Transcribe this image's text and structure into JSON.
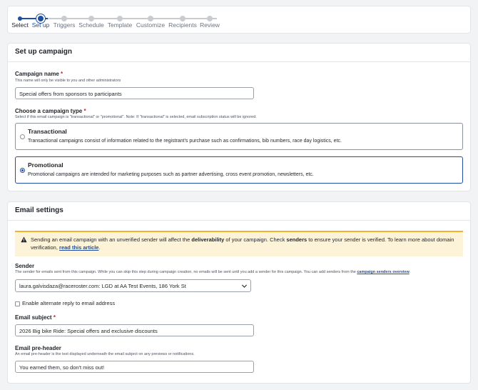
{
  "stepper": {
    "steps": [
      {
        "label": "Select",
        "state": "done"
      },
      {
        "label": "Set up",
        "state": "active"
      },
      {
        "label": "Triggers",
        "state": "upcoming"
      },
      {
        "label": "Schedule",
        "state": "upcoming"
      },
      {
        "label": "Template",
        "state": "upcoming"
      },
      {
        "label": "Customize",
        "state": "upcoming"
      },
      {
        "label": "Recipients",
        "state": "upcoming"
      },
      {
        "label": "Review",
        "state": "upcoming"
      }
    ]
  },
  "setup": {
    "title": "Set up campaign",
    "campaign_name": {
      "label": "Campaign name",
      "required_mark": "*",
      "help": "This name will only be visible to you and other administrators",
      "value": "Special offers from sponsors to participants"
    },
    "campaign_type": {
      "label": "Choose a campaign type",
      "required_mark": "*",
      "help": "Select if this email campaign is \"transactional\" or \"promotional\". Note: If \"transactional\" is selected, email subscription status will be ignored.",
      "options": [
        {
          "title": "Transactional",
          "description": "Transactional campaigns consist of information related to the registrant's purchase such as confirmations, bib numbers, race day logistics, etc.",
          "selected": false
        },
        {
          "title": "Promotional",
          "description": "Promotional campaigns are intended for marketing purposes such as partner advertising, cross event promotion, newsletters, etc.",
          "selected": true
        }
      ]
    }
  },
  "email": {
    "title": "Email settings",
    "warning": {
      "icon": "warning-triangle-icon",
      "part1": "Sending an email campaign with an unverified sender will affect the ",
      "bold1": "deliverability",
      "part2": " of your campaign. Check ",
      "bold2": "senders",
      "part3": " to ensure your sender is verified. To learn more about domain verification, ",
      "link": "read this article",
      "part4": ".",
      "bg_color": "#fdf3d9",
      "accent_color": "#f0b429"
    },
    "sender": {
      "label": "Sender",
      "help": "The sender for emails sent from this campaign. While you can skip this step during campaign creation, no emails will be sent until you add a sender for this campaign. You can add senders from the ",
      "help_link": "campaign senders overview",
      "help_end": ".",
      "value": "laura.galvisdaza@raceroster.com: LGD at AA Test Events, 186 York St"
    },
    "alt_reply": {
      "label": "Enable alternate reply to email address",
      "checked": false
    },
    "subject": {
      "label": "Email subject",
      "required_mark": "*",
      "value": "2026 Big bike Ride: Special offers and exclusive discounts"
    },
    "preheader": {
      "label": "Email pre-header",
      "help": "An email pre-header is the text displayed underneath the email subject on any previews or notifications.",
      "value": "You earned them, so don't miss out!"
    }
  },
  "colors": {
    "primary": "#1f4fa0",
    "required": "#c0262d",
    "border": "#9aa1ab"
  }
}
